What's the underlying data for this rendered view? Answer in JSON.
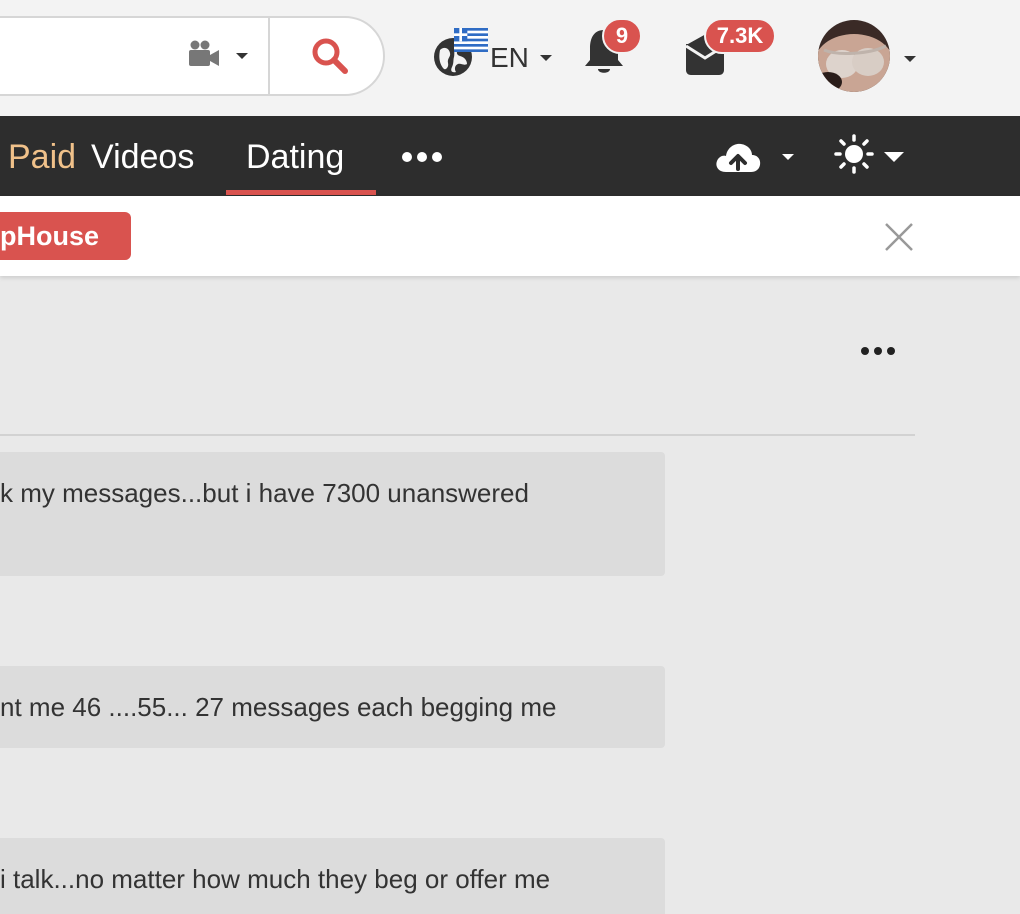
{
  "header": {
    "search": {
      "value": "",
      "placeholder": ""
    },
    "camera_selector_icon": "video-camera-icon",
    "search_icon": "search-icon",
    "language": {
      "code": "EN",
      "flag": "greece-flag-icon"
    },
    "notifications": {
      "count": "9"
    },
    "messages": {
      "count": "7.3K"
    },
    "avatar": "user-avatar"
  },
  "navbar": {
    "items": [
      {
        "label": "Paid",
        "color": "#f0c18a"
      },
      {
        "label": "Videos"
      },
      {
        "label": "Dating",
        "active": true
      }
    ],
    "more_icon": "more-horizontal-icon",
    "upload_icon": "cloud-upload-icon",
    "theme_icon": "sun-icon"
  },
  "announcement": {
    "tag_label": "pHouse",
    "close_icon": "close-icon"
  },
  "post": {
    "menu_icon": "more-horizontal-icon",
    "messages": [
      {
        "text": "k my messages...but i have 7300 unanswered"
      },
      {
        "text": "nt me 46 ....55... 27 messages each begging me"
      },
      {
        "text": "i talk...no matter how much they beg or offer me"
      }
    ]
  },
  "colors": {
    "accent": "#d9534f",
    "navbar_bg": "#2d2d2d",
    "header_bg": "#f3f3f3",
    "content_bg": "#e9e9e9",
    "bubble_bg": "#dcdcdc"
  }
}
